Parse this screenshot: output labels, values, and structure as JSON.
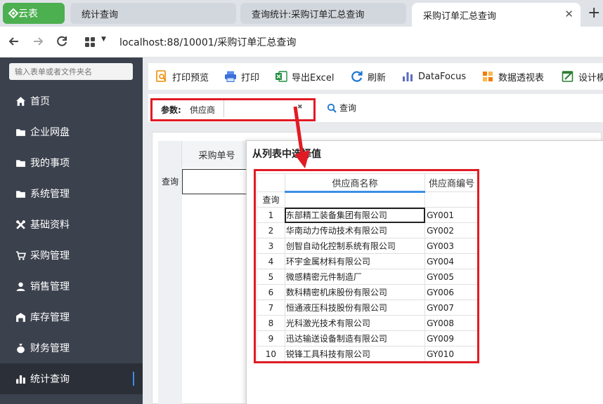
{
  "browser": {
    "app_tab": "云表",
    "tabs": [
      {
        "label": "统计查询"
      },
      {
        "label": "查询统计:采购订单汇总查询"
      },
      {
        "label": "采购订单汇总查询"
      }
    ],
    "close_glyph": "✕",
    "new_tab_glyph": "+",
    "url": "localhost:88/10001/采购订单汇总查询"
  },
  "sidebar": {
    "search_placeholder": "输入表单或者文件夹名",
    "items": [
      {
        "label": "首页",
        "icon": "home-icon"
      },
      {
        "label": "企业网盘",
        "icon": "folder-icon"
      },
      {
        "label": "我的事项",
        "icon": "folder-icon"
      },
      {
        "label": "系统管理",
        "icon": "folder-icon"
      },
      {
        "label": "基础资料",
        "icon": "tools-icon"
      },
      {
        "label": "采购管理",
        "icon": "cart-icon"
      },
      {
        "label": "销售管理",
        "icon": "user-icon"
      },
      {
        "label": "库存管理",
        "icon": "warehouse-icon"
      },
      {
        "label": "财务管理",
        "icon": "moneybag-icon"
      },
      {
        "label": "统计查询",
        "icon": "chart-icon"
      }
    ]
  },
  "toolbar": {
    "print_preview": "打印预览",
    "print": "打印",
    "export_excel": "导出Excel",
    "refresh": "刷新",
    "datafocus": "DataFocus",
    "pivot": "数据透视表",
    "design": "设计模"
  },
  "params": {
    "label": "参数:",
    "name": "供应商",
    "value": "",
    "clear_glyph": "✖",
    "query": "查询"
  },
  "bg_grid": {
    "col_header": "采购单号",
    "row_label": "查询"
  },
  "dialog": {
    "title": "从列表中选择值",
    "headers": {
      "name": "供应商名称",
      "code": "供应商编号"
    },
    "query_row": "查询",
    "rows": [
      {
        "n": "1",
        "name": "东部精工装备集团有限公司",
        "code": "GY001"
      },
      {
        "n": "2",
        "name": "华南动力传动技术有限公司",
        "code": "GY002"
      },
      {
        "n": "3",
        "name": "创智自动化控制系统有限公司",
        "code": "GY003"
      },
      {
        "n": "4",
        "name": "环宇金属材料有限公司",
        "code": "GY004"
      },
      {
        "n": "5",
        "name": "微感精密元件制造厂",
        "code": "GY005"
      },
      {
        "n": "6",
        "name": "数科精密机床股份有限公司",
        "code": "GY006"
      },
      {
        "n": "7",
        "name": "恒通液压科技股份有限公司",
        "code": "GY007"
      },
      {
        "n": "8",
        "name": "光科激光技术有限公司",
        "code": "GY008"
      },
      {
        "n": "9",
        "name": "迅达输送设备制造有限公司",
        "code": "GY009"
      },
      {
        "n": "10",
        "name": "锐锋工具科技有限公司",
        "code": "GY010"
      }
    ]
  },
  "colors": {
    "brand_green": "#4caf50",
    "sidebar_bg": "#3b414d",
    "highlight_red": "#e01b24",
    "accent_blue": "#3a8ee6"
  }
}
